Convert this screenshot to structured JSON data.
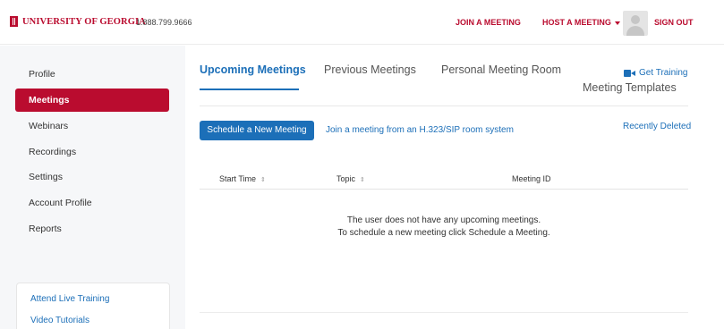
{
  "header": {
    "logo_text": "UNIVERSITY OF GEORGIA",
    "phone": "1.888.799.9666",
    "join_meeting": "JOIN A MEETING",
    "host_meeting": "HOST A MEETING",
    "sign_out": "SIGN OUT",
    "brand_color": "#ba0c2f"
  },
  "sidebar": {
    "items": [
      {
        "label": "Profile",
        "active": false
      },
      {
        "label": "Meetings",
        "active": true
      },
      {
        "label": "Webinars",
        "active": false
      },
      {
        "label": "Recordings",
        "active": false
      },
      {
        "label": "Settings",
        "active": false
      },
      {
        "label": "Account Profile",
        "active": false
      },
      {
        "label": "Reports",
        "active": false
      }
    ],
    "links": [
      "Attend Live Training",
      "Video Tutorials"
    ]
  },
  "main": {
    "tabs": [
      {
        "label": "Upcoming Meetings",
        "active": true
      },
      {
        "label": "Previous Meetings",
        "active": false
      },
      {
        "label": "Personal Meeting Room",
        "active": false
      },
      {
        "label": "Meeting Templates",
        "active": false
      }
    ],
    "get_training": "Get Training",
    "schedule_button": "Schedule a New Meeting",
    "join_sip": "Join a meeting from an H.323/SIP room system",
    "recently_deleted": "Recently Deleted",
    "table": {
      "columns": [
        "Start Time",
        "Topic",
        "Meeting ID"
      ]
    },
    "empty_line_1": "The user does not have any upcoming meetings.",
    "empty_line_2": "To schedule a new meeting click Schedule a Meeting.",
    "accent_color": "#1c6fb8"
  }
}
